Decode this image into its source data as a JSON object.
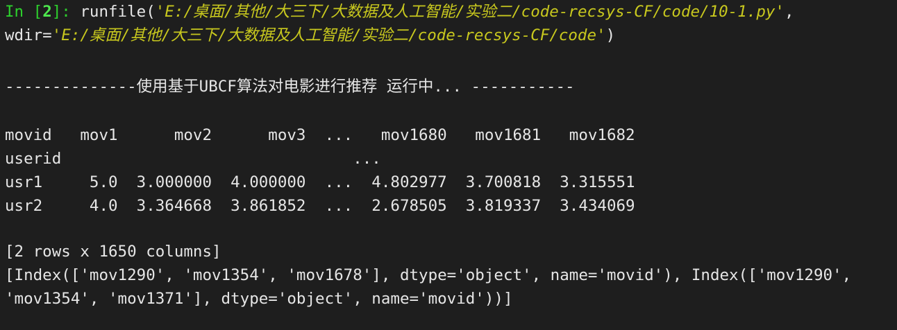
{
  "console": {
    "prompt": {
      "in_label": "In [",
      "number": "2",
      "close": "]: "
    },
    "command": {
      "func_open": "runfile(",
      "path1": "'E:/桌面/其他/大三下/大数据及人工智能/实验二/code-recsys-CF/code/10-1.py'",
      "sep": ",",
      "wdir_label": "wdir=",
      "path2": "'E:/桌面/其他/大三下/大数据及人工智能/实验二/code-recsys-CF/code'",
      "func_close": ")"
    },
    "banner": "--------------使用基于UBCF算法对电影进行推荐 运行中... -----------",
    "table": {
      "header": "movid   mov1      mov2      mov3  ...   mov1680   mov1681   mov1682",
      "index_name": "userid                               ...",
      "rows": [
        "usr1     5.0  3.000000  4.000000  ...  4.802977  3.700818  3.315551",
        "usr2     4.0  3.364668  3.861852  ...  2.678505  3.819337  3.434069"
      ]
    },
    "shape": "[2 rows x 1650 columns]",
    "index_line1": "[Index(['mov1290', 'mov1354', 'mov1678'], dtype='object', name='movid'), Index(['mov1290',",
    "index_line2": "'mov1354', 'mov1371'], dtype='object', name='movid'))]"
  }
}
